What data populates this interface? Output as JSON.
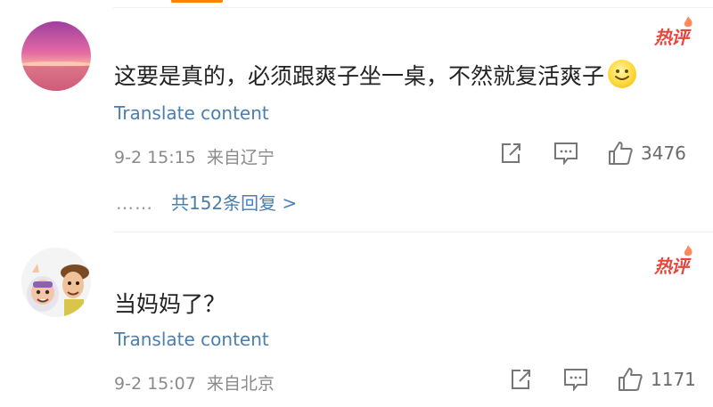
{
  "comments": [
    {
      "text": "这要是真的，必须跟爽子坐一桌，不然就复活爽子",
      "hot_badge": "热评",
      "translate": "Translate content",
      "time": "9-2 15:15",
      "location": "来自辽宁",
      "likes": "3476",
      "replies": {
        "dots": "……",
        "label": "共152条回复 >"
      }
    },
    {
      "text": "当妈妈了？",
      "hot_badge": "热评",
      "translate": "Translate content",
      "time": "9-2 15:07",
      "location": "来自北京",
      "likes": "1171"
    }
  ],
  "icons": [
    "share-icon",
    "comment-icon",
    "like-icon",
    "smile-emoji-icon"
  ],
  "colors": {
    "link": "#4a7eb0",
    "hot": "#e8463c",
    "meta": "#8a8a8a",
    "tab": "#ff8200"
  }
}
